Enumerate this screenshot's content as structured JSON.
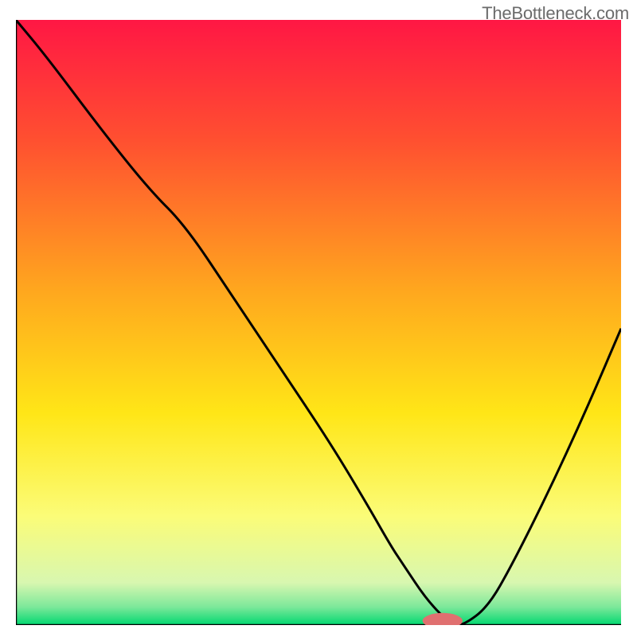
{
  "watermark": "TheBottleneck.com",
  "chart_data": {
    "type": "line",
    "title": "",
    "xlabel": "",
    "ylabel": "",
    "xlim": [
      0,
      100
    ],
    "ylim": [
      0,
      100
    ],
    "grid": false,
    "gradient_background": {
      "stops": [
        {
          "offset": 0.0,
          "color": "#ff1744"
        },
        {
          "offset": 0.2,
          "color": "#ff5030"
        },
        {
          "offset": 0.45,
          "color": "#ffa81e"
        },
        {
          "offset": 0.65,
          "color": "#ffe617"
        },
        {
          "offset": 0.82,
          "color": "#fbfc78"
        },
        {
          "offset": 0.93,
          "color": "#d8f7b0"
        },
        {
          "offset": 0.97,
          "color": "#7de89a"
        },
        {
          "offset": 1.0,
          "color": "#00d870"
        }
      ]
    },
    "series": [
      {
        "name": "bottleneck-curve",
        "x": [
          0,
          5,
          14,
          22,
          28,
          36,
          44,
          52,
          58,
          62,
          64,
          68,
          72,
          74,
          78,
          82,
          88,
          94,
          100
        ],
        "values": [
          100,
          94,
          82,
          72,
          66,
          54,
          42,
          30,
          20,
          13,
          10,
          4,
          0,
          0,
          3,
          10,
          22,
          35,
          49
        ]
      }
    ],
    "marker": {
      "name": "optimal-point",
      "x_center": 70.5,
      "y": 0.7,
      "rx": 3.3,
      "ry": 1.3,
      "color": "#e07070"
    }
  }
}
